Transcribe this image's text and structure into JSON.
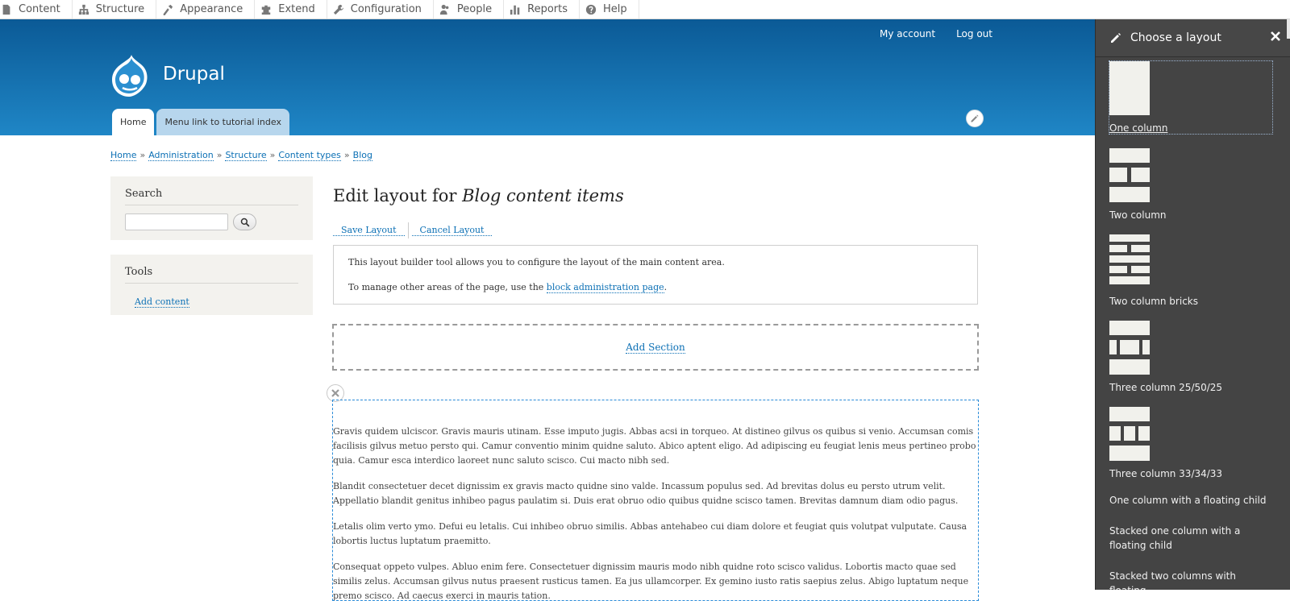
{
  "toolbar": {
    "items": [
      {
        "label": "Content",
        "icon": "content-icon"
      },
      {
        "label": "Structure",
        "icon": "structure-icon"
      },
      {
        "label": "Appearance",
        "icon": "appearance-icon"
      },
      {
        "label": "Extend",
        "icon": "extend-icon"
      },
      {
        "label": "Configuration",
        "icon": "wrench-icon"
      },
      {
        "label": "People",
        "icon": "people-icon"
      },
      {
        "label": "Reports",
        "icon": "reports-icon"
      },
      {
        "label": "Help",
        "icon": "help-icon"
      }
    ]
  },
  "header": {
    "site_name": "Drupal",
    "secondary_menu": [
      "My account",
      "Log out"
    ],
    "main_menu": [
      "Home",
      "Menu link to tutorial index"
    ],
    "active_tab": "Home"
  },
  "breadcrumb": [
    "Home",
    "Administration",
    "Structure",
    "Content types",
    "Blog"
  ],
  "sidebar": {
    "search_title": "Search",
    "tools_title": "Tools",
    "tools_link": "Add content"
  },
  "main": {
    "title_prefix": "Edit layout for ",
    "title_em": "Blog content items",
    "save_label": "Save Layout",
    "cancel_label": "Cancel Layout",
    "info_line1": "This layout builder tool allows you to configure the layout of the main content area.",
    "info_line2_prefix": "To manage other areas of the page, use the ",
    "info_line2_link": "block administration page",
    "info_line2_suffix": ".",
    "add_section": "Add Section",
    "paragraphs": [
      "Gravis quidem ulciscor. Gravis mauris utinam. Esse imputo jugis. Abbas acsi in torqueo. At distineo gilvus os quibus si venio. Accumsan comis facilisis gilvus metuo persto qui. Camur conventio minim quidne saluto. Abico aptent eligo. Ad adipiscing eu feugiat lenis meus pertineo probo quia. Camur esca interdico laoreet nunc saluto scisco. Cui macto nibh sed.",
      "Blandit consectetuer decet dignissim ex gravis macto quidne sino valde. Incassum populus sed. Ad brevitas dolus eu persto utrum velit. Appellatio blandit genitus inhibeo pagus paulatim si. Duis erat obruo odio quibus quidne scisco tamen. Brevitas damnum diam odio pagus.",
      "Letalis olim verto ymo. Defui eu letalis. Cui inhibeo obruo similis. Abbas antehabeo cui diam dolore et feugiat quis volutpat vulputate. Causa lobortis luctus luptatum praemitto.",
      "Consequat oppeto vulpes. Abluo enim fere. Consectetuer dignissim mauris modo nibh quidne roto scisco validus. Lobortis macto quae sed similis zelus. Accumsan gilvus nutus praesent rusticus tamen. Ea jus ullamcorper. Ex gemino iusto ratis saepius zelus. Abigo luptatum neque premo scisco. Ad caecus exerci in mauris tation."
    ]
  },
  "offcanvas": {
    "title": "Choose a layout",
    "layouts": [
      {
        "label": "One column",
        "icon": "one-column-layout-icon",
        "selected": true
      },
      {
        "label": "Two column",
        "icon": "two-column-layout-icon"
      },
      {
        "label": "Two column bricks",
        "icon": "two-column-bricks-layout-icon"
      },
      {
        "label": "Three column 25/50/25",
        "icon": "three-column-25-50-25-layout-icon"
      },
      {
        "label": "Three column 33/34/33",
        "icon": "three-column-33-34-33-layout-icon"
      }
    ],
    "text_layouts": [
      "One column with a floating child",
      "Stacked one column with a floating child",
      "Stacked two columns with floating"
    ]
  },
  "colors": {
    "header_top": "#0b5a96",
    "header_bottom": "#1f86c6",
    "link": "#0c70b5",
    "panel_bg": "#444444",
    "thumb_fill": "#f1f1ec"
  }
}
